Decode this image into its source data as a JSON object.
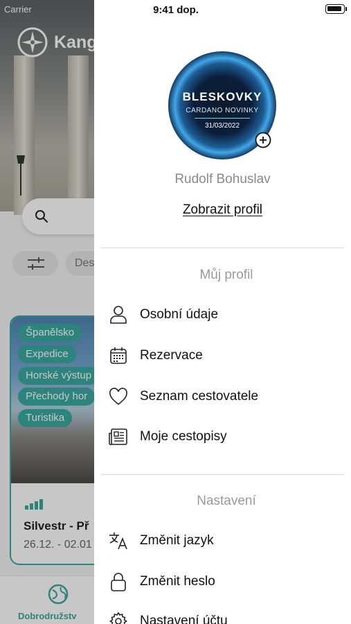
{
  "status_bar": {
    "time": "9:41 dop.",
    "carrier": "Carrier"
  },
  "background": {
    "brand_name": "Kang",
    "filter_chip_partial": "Des",
    "card": {
      "tags": [
        "Španělsko",
        "Expedice",
        "Horské výstup",
        "Přechody hor",
        "Turistika"
      ],
      "title": "Silvestr - Př",
      "dates": "26.12. - 02.01"
    },
    "bottom_nav": {
      "active_label": "Dobrodružstv"
    },
    "accent_color": "#3aa99f"
  },
  "drawer": {
    "avatar": {
      "line1": "BLESKOVKY",
      "line2": "CARDANO NOVINKY",
      "line3": "31/03/2022"
    },
    "user_name": "Rudolf Bohuslav",
    "view_profile_label": "Zobrazit profil",
    "sections": {
      "profile": {
        "title": "Můj profil",
        "items": [
          {
            "label": "Osobní údaje",
            "icon": "user-icon"
          },
          {
            "label": "Rezervace",
            "icon": "calendar-icon"
          },
          {
            "label": "Seznam cestovatele",
            "icon": "heart-icon"
          },
          {
            "label": "Moje cestopisy",
            "icon": "newspaper-icon"
          }
        ]
      },
      "settings": {
        "title": "Nastavení",
        "items": [
          {
            "label": "Změnit jazyk",
            "icon": "translate-icon"
          },
          {
            "label": "Změnit heslo",
            "icon": "lock-icon"
          },
          {
            "label": "Nastavení účtu",
            "icon": "gear-icon"
          }
        ]
      }
    }
  }
}
